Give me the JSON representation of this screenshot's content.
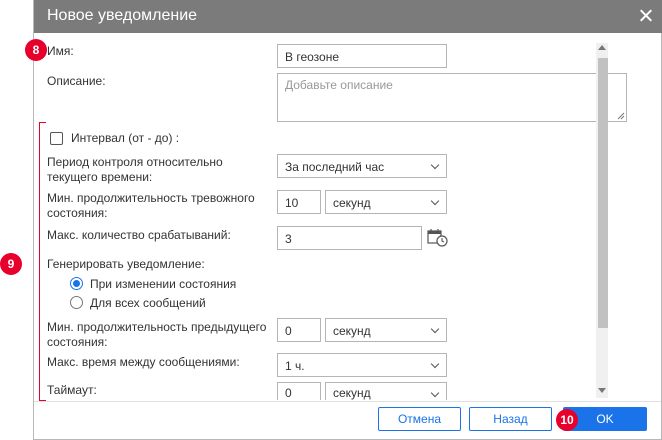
{
  "dialog": {
    "title": "Новое уведомление"
  },
  "form": {
    "name_label": "Имя:",
    "name_value": "В геозоне",
    "description_label": "Описание:",
    "description_placeholder": "Добавьте описание",
    "interval_label": "Интервал (от - до)  :",
    "period_label": "Период контроля относительно текущего времени:",
    "period_value": "За последний час",
    "min_alarm_label": "Мин. продолжительность тревожного состояния:",
    "min_alarm_value": "10",
    "min_alarm_unit": "секунд",
    "max_trigger_label": "Макс. количество срабатываний:",
    "max_trigger_value": "3",
    "generate_label": "Генерировать уведомление:",
    "radio_state_change": "При изменении состояния",
    "radio_all_messages": "Для всех сообщений",
    "min_prev_label": "Мин. продолжительность предыдущего состояния:",
    "min_prev_value": "0",
    "min_prev_unit": "секунд",
    "max_between_label": "Макс. время между сообщениями:",
    "max_between_value": "1 ч.",
    "timeout_label": "Таймаут:",
    "timeout_value": "0",
    "timeout_unit": "секунд"
  },
  "footer": {
    "cancel": "Отмена",
    "back": "Назад",
    "ok": "OK"
  },
  "callouts": {
    "c8": "8",
    "c9": "9",
    "c10": "10"
  },
  "colors": {
    "accent": "#1a73e8",
    "titlebar": "#7b7b7b",
    "callout": "#e8002d"
  },
  "icons": {
    "calendar": "calendar-clock-icon",
    "close": "close-icon"
  },
  "state": {
    "interval_checked": false,
    "selected_radio": "При изменении состояния"
  }
}
